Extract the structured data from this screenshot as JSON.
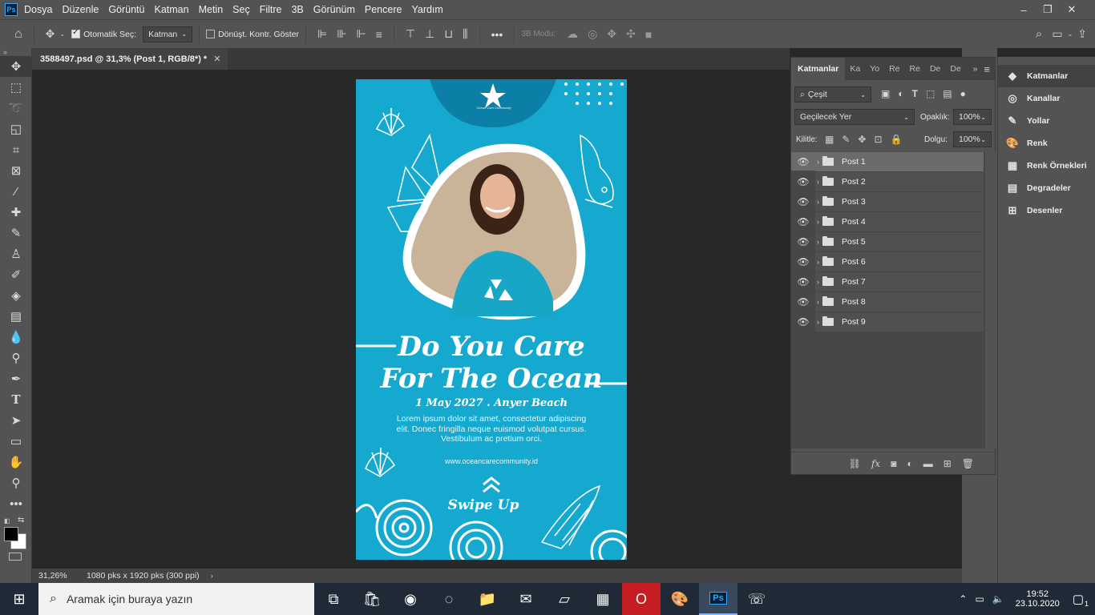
{
  "app": {
    "logo": "Ps"
  },
  "menu": [
    "Dosya",
    "Düzenle",
    "Görüntü",
    "Katman",
    "Metin",
    "Seç",
    "Filtre",
    "3B",
    "Görünüm",
    "Pencere",
    "Yardım"
  ],
  "window_controls": {
    "minimize": "–",
    "restore": "❐",
    "close": "✕"
  },
  "options": {
    "auto_select_label": "Otomatik Seç:",
    "auto_select_checked": true,
    "auto_select_target": "Katman",
    "transform_label": "Dönüşt. Kontr. Göster",
    "mode_3d_label": "3B Modu:",
    "more": "•••"
  },
  "document": {
    "tab_title": "3588497.psd @ 31,3% (Post 1, RGB/8*) *",
    "close": "✕",
    "zoom": "31,26%",
    "dimensions": "1080 pks x 1920 pks (300 ppi)"
  },
  "poster": {
    "brand": "Ocean Care Community",
    "headline_1": "Do You Care",
    "headline_2": "For The Ocean",
    "date_line": "1 May 2027  .  Anyer Beach",
    "body": "Lorem ipsum dolor sit amet, consectetur adipiscing elit. Donec fringilla neque euismod volutpat cursus. Vestibulum ac pretium orci.",
    "website": "www.oceancarecommunity.id",
    "cta": "Swipe Up",
    "colors": {
      "background": "#16a9d0",
      "accent_dark": "#0b7fa6",
      "text": "#ffffff"
    }
  },
  "layers_panel": {
    "tabs": [
      "Katmanlar",
      "Ka",
      "Yo",
      "Re",
      "Re",
      "De",
      "De"
    ],
    "filter": "Çeşit",
    "blend_mode": "Geçilecek Yer",
    "opacity_label": "Opaklık:",
    "opacity": "100%",
    "lock_label": "Kilitle:",
    "fill_label": "Dolgu:",
    "fill": "100%",
    "layers": [
      {
        "name": "Post 1",
        "selected": true
      },
      {
        "name": "Post 2",
        "selected": false
      },
      {
        "name": "Post 3",
        "selected": false
      },
      {
        "name": "Post 4",
        "selected": false
      },
      {
        "name": "Post 5",
        "selected": false
      },
      {
        "name": "Post 6",
        "selected": false
      },
      {
        "name": "Post 7",
        "selected": false
      },
      {
        "name": "Post 8",
        "selected": false
      },
      {
        "name": "Post 9",
        "selected": false
      }
    ]
  },
  "right_panels": [
    "Katmanlar",
    "Kanallar",
    "Yollar",
    "Renk",
    "Renk Örnekleri",
    "Degradeler",
    "Desenler"
  ],
  "taskbar": {
    "search_placeholder": "Aramak için buraya yazın",
    "time": "19:52",
    "date": "23.10.2020",
    "notification_count": "1"
  }
}
